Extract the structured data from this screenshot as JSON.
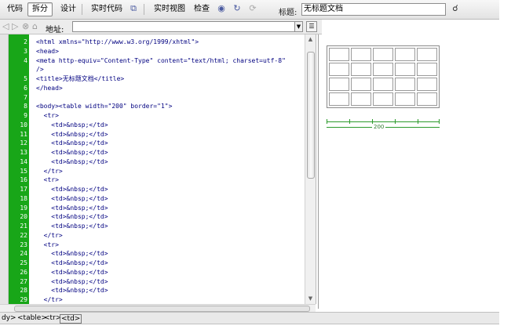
{
  "toolbar": {
    "code_btn": "代码",
    "split_btn": "拆分",
    "design_btn": "设计",
    "live_code_btn": "实时代码",
    "live_view_btn": "实时视图",
    "inspect_btn": "检查",
    "title_label": "标题:",
    "title_value": "无标题文档"
  },
  "address": {
    "label": "地址:"
  },
  "code_lines": [
    {
      "n": "2",
      "t": "<html xmlns=\"http://www.w3.org/1999/xhtml\">"
    },
    {
      "n": "3",
      "t": "<head>"
    },
    {
      "n": "4",
      "t": "<meta http-equiv=\"Content-Type\" content=\"text/html; charset=utf-8\""
    },
    {
      "n": "",
      "t": "/>"
    },
    {
      "n": "5",
      "t": "<title>无标题文档</title>"
    },
    {
      "n": "6",
      "t": "</head>"
    },
    {
      "n": "7",
      "t": ""
    },
    {
      "n": "8",
      "t": "<body><table width=\"200\" border=\"1\">"
    },
    {
      "n": "9",
      "t": "  <tr>"
    },
    {
      "n": "10",
      "t": "    <td>&nbsp;</td>"
    },
    {
      "n": "11",
      "t": "    <td>&nbsp;</td>"
    },
    {
      "n": "12",
      "t": "    <td>&nbsp;</td>"
    },
    {
      "n": "13",
      "t": "    <td>&nbsp;</td>"
    },
    {
      "n": "14",
      "t": "    <td>&nbsp;</td>"
    },
    {
      "n": "15",
      "t": "  </tr>"
    },
    {
      "n": "16",
      "t": "  <tr>"
    },
    {
      "n": "17",
      "t": "    <td>&nbsp;</td>"
    },
    {
      "n": "18",
      "t": "    <td>&nbsp;</td>"
    },
    {
      "n": "19",
      "t": "    <td>&nbsp;</td>"
    },
    {
      "n": "20",
      "t": "    <td>&nbsp;</td>"
    },
    {
      "n": "21",
      "t": "    <td>&nbsp;</td>"
    },
    {
      "n": "22",
      "t": "  </tr>"
    },
    {
      "n": "23",
      "t": "  <tr>"
    },
    {
      "n": "24",
      "t": "    <td>&nbsp;</td>"
    },
    {
      "n": "25",
      "t": "    <td>&nbsp;</td>"
    },
    {
      "n": "26",
      "t": "    <td>&nbsp;</td>"
    },
    {
      "n": "27",
      "t": "    <td>&nbsp;</td>"
    },
    {
      "n": "28",
      "t": "    <td>&nbsp;</td>"
    },
    {
      "n": "29",
      "t": "  </tr>"
    }
  ],
  "design": {
    "width_label": "200"
  },
  "status": {
    "crumbs": [
      "dy>",
      "<table>",
      "<tr>",
      "<td>"
    ]
  }
}
